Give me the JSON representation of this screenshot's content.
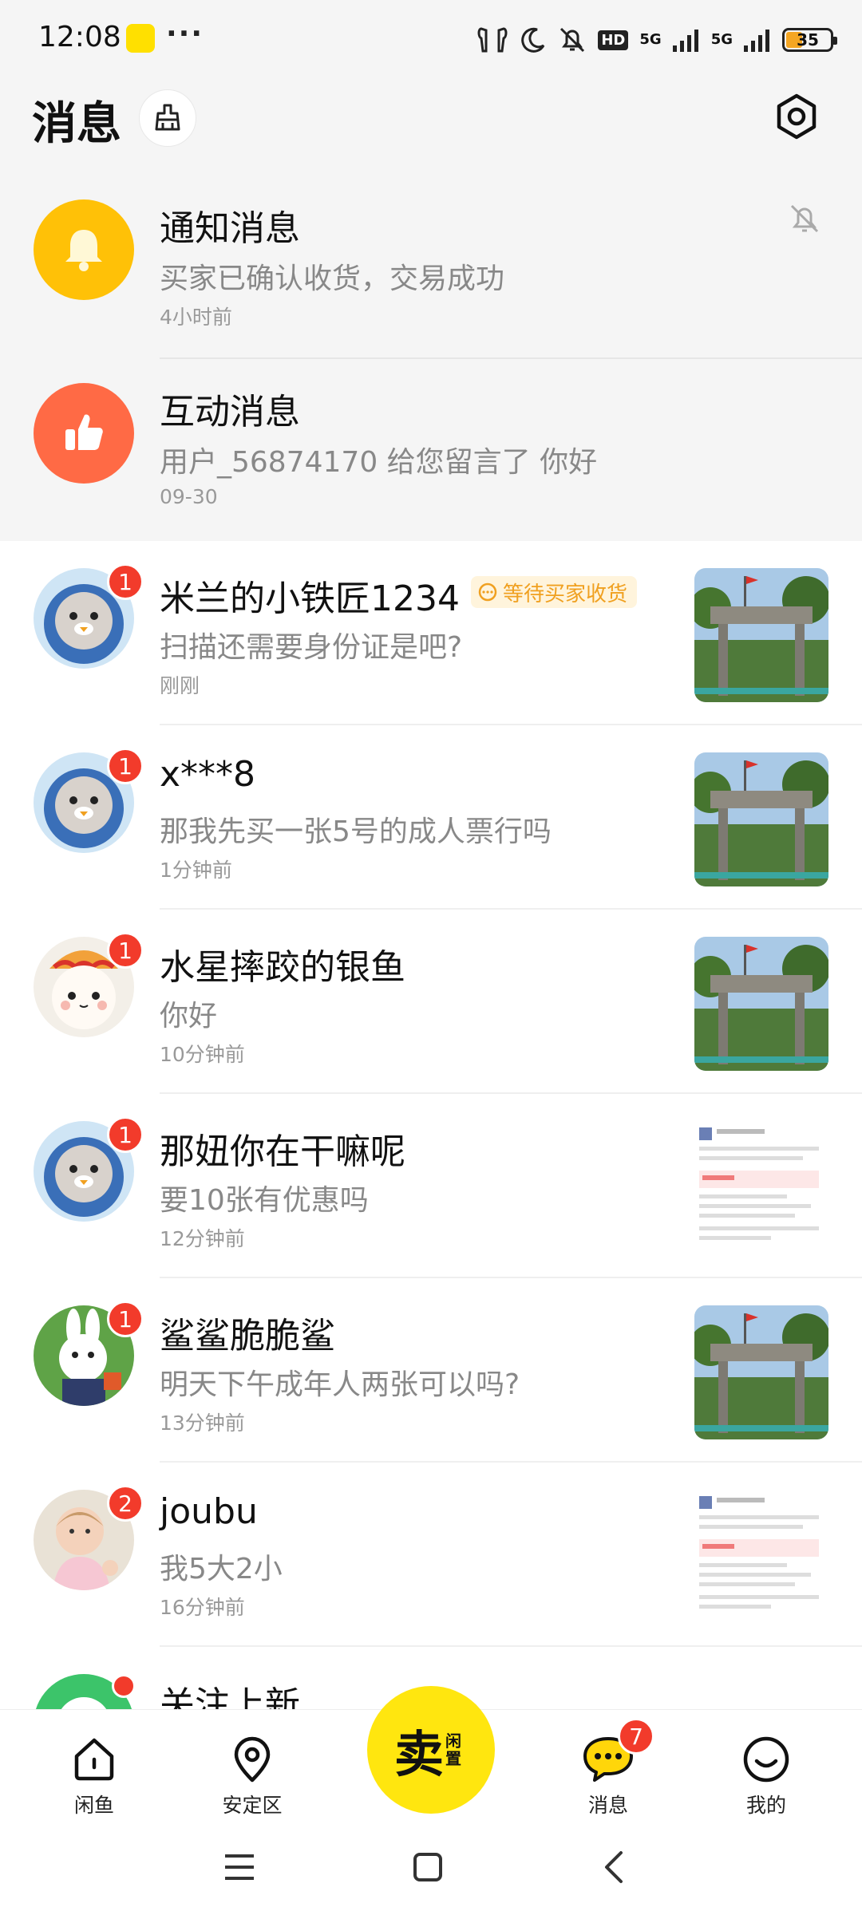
{
  "status_bar": {
    "time": "12:08",
    "dots": "···",
    "network_1": "5G",
    "network_2": "5G",
    "hd": "HD",
    "battery": "35"
  },
  "header": {
    "title": "消息"
  },
  "system_messages": [
    {
      "title": "通知消息",
      "subtitle": "买家已确认收货，交易成功",
      "time": "4小时前",
      "icon": "bell-icon",
      "color": "#ffc107"
    },
    {
      "title": "互动消息",
      "subtitle": "用户_56874170 给您留言了 你好",
      "time": "09-30",
      "icon": "thumbs-up-icon",
      "color": "#ff6a45"
    }
  ],
  "chats": [
    {
      "name": "米兰的小铁匠1234",
      "tag": "等待买家收货",
      "message": "扫描还需要身份证是吧?",
      "time": "刚刚",
      "badge": "1",
      "avatar": "cat-avatar",
      "thumb": "gate-photo"
    },
    {
      "name": "x***8",
      "message": "那我先买一张5号的成人票行吗",
      "time": "1分钟前",
      "badge": "1",
      "avatar": "cat-avatar",
      "thumb": "gate-photo"
    },
    {
      "name": "水星摔跤的银鱼",
      "message": "你好",
      "time": "10分钟前",
      "badge": "1",
      "avatar": "kitty-avatar",
      "thumb": "gate-photo"
    },
    {
      "name": "那妞你在干嘛呢",
      "message": "要10张有优惠吗",
      "time": "12分钟前",
      "badge": "1",
      "avatar": "cat-avatar",
      "thumb": "doc-screenshot"
    },
    {
      "name": "鲨鲨脆脆鲨",
      "message": "明天下午成年人两张可以吗?",
      "time": "13分钟前",
      "badge": "1",
      "avatar": "rabbit-avatar",
      "thumb": "gate-photo"
    },
    {
      "name": "joubu",
      "message": "我5大2小",
      "time": "16分钟前",
      "badge": "2",
      "avatar": "baby-avatar",
      "thumb": "doc-screenshot"
    },
    {
      "name": "关注上新",
      "avatar": "green-avatar"
    }
  ],
  "bottom_nav": {
    "home": "闲鱼",
    "area": "安定区",
    "sell_main": "卖",
    "sell_sub": "闲置",
    "messages": "消息",
    "messages_badge": "7",
    "me": "我的"
  }
}
